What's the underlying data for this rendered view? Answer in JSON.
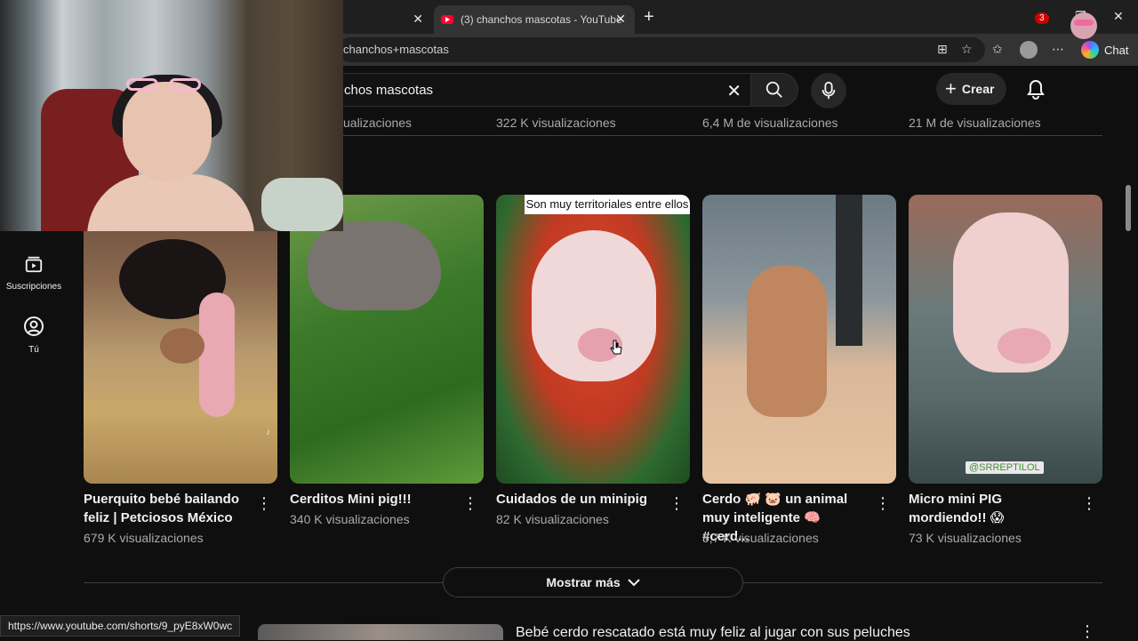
{
  "browser": {
    "tabs": [
      {
        "title": ""
      },
      {
        "title": "(3) chanchos mascotas - YouTube"
      }
    ],
    "url": "chanchos+mascotas",
    "chat_label": "Chat",
    "status_url": "https://www.youtube.com/shorts/9_pyE8xW0wc"
  },
  "masthead": {
    "search_query": "chos mascotas",
    "create_label": "Crear",
    "notification_count": "3"
  },
  "sidebar": {
    "items": [
      {
        "label": "Suscripciones",
        "icon": "subscriptions-icon"
      },
      {
        "label": "Tú",
        "icon": "you-icon"
      }
    ]
  },
  "previous_row": {
    "views": [
      "ualizaciones",
      "322 K visualizaciones",
      "6,4 M de visualizaciones",
      "21 M de visualizaciones"
    ]
  },
  "shorts": [
    {
      "title": "Puerquito bebé bailando feliz | Petciosos México",
      "views": "679 K visualizaciones"
    },
    {
      "title": "Cerditos Mini pig!!!",
      "views": "340 K visualizaciones"
    },
    {
      "title": "Cuidados de un minipig",
      "views": "82 K visualizaciones",
      "caption": "Son muy territoriales entre ellos"
    },
    {
      "title": "Cerdo 🐖 🐷 un animal muy inteligente 🧠 #cerd...",
      "views": "5,7 K visualizaciones"
    },
    {
      "title": "Micro mini PIG mordiendo!! 😱",
      "views": "73 K visualizaciones",
      "watermark": "@SRREPTILOL"
    }
  ],
  "show_more_label": "Mostrar más",
  "next_video_title": "Bebé cerdo rescatado está muy feliz al jugar con sus peluches",
  "colors": {
    "background": "#0f0f0f",
    "youtube_red": "#ff0033",
    "badge_red": "#cc0000",
    "text_secondary": "#aaaaaa"
  }
}
